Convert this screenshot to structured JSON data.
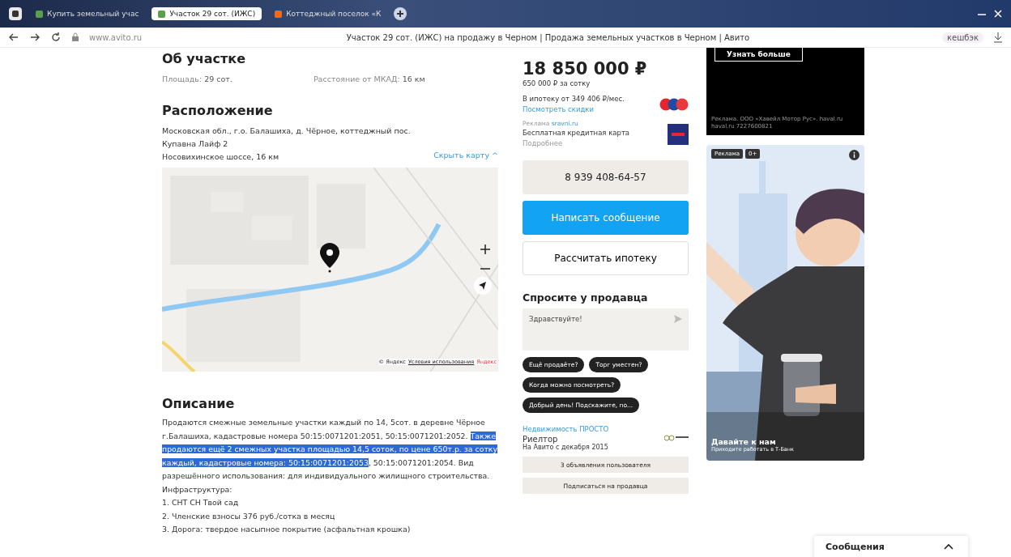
{
  "browser": {
    "tabs": [
      {
        "label": "Купить земельный учас",
        "selected": false
      },
      {
        "label": "Участок 29 сот. (ИЖС)",
        "selected": true
      },
      {
        "label": "Коттеджный поселок «К",
        "selected": false
      }
    ],
    "address": "www.avito.ru",
    "page_title": "Участок 29 сот. (ИЖС) на продажу в Черном | Продажа земельных участков в Черном | Авито",
    "cashback": "кешбэк"
  },
  "about": {
    "heading": "Об участке",
    "params": [
      {
        "label": "Площадь:",
        "value": "29 сот."
      },
      {
        "label": "Расстояние от МКАД:",
        "value": "16 км"
      }
    ]
  },
  "location": {
    "heading": "Расположение",
    "address_lines": [
      "Московская обл., г.о. Балашиха, д. Чёрное, коттеджный пос.",
      "Купавна Лайф 2"
    ],
    "highway": "Носовихинское шоссе, 16 км",
    "hide_map": "Скрыть карту ^",
    "map": {
      "attribution": "© Яндекс",
      "terms": "Условия использования",
      "brand": "Яндекс"
    }
  },
  "description": {
    "heading": "Описание",
    "paragraph": [
      {
        "text": "Продаются смежные земельные участки каждый по 14, 5сот. в деревне Чёрное г.Балашиха, кадастровые номера 50:15:0071201:2051, 50:15:0071201:2052. ",
        "selected": false
      },
      {
        "text": "Также продаются ещё 2 смежных участка площадью 14,5 соток, по цене 650т.р. за сотку каждый, кадастровые номера: 50:15:0071201:2053",
        "selected": true
      },
      {
        "text": ", 50:15:0071201:2054. Вид разрешённого использования: для индивидуального жилищного строительства.",
        "selected": false
      }
    ],
    "lines": [
      "Инфраструктура:",
      "1. СНТ СН Твой сад",
      "2. Членские взносы 376 руб./сотка в месяц",
      "3. Дорога: твердое насыпное покрытие (асфальтная крошка)"
    ]
  },
  "price": {
    "amount": "18 850 000 ₽",
    "per_unit": "650 000 ₽ за сотку",
    "mortgage": "В ипотеку от 349 406 ₽/мес.",
    "discounts_link": "Посмотреть скидки",
    "ad_label": "Реклама",
    "ad_site": "sravni.ru",
    "card_offer": "Бесплатная кредитная карта",
    "card_more": "Подробнее"
  },
  "phone_button": "8 939 408-64-57",
  "message_button": "Написать сообщение",
  "mortgage_button": "Рассчитать ипотеку",
  "ask": {
    "heading": "Спросите у продавца",
    "message": "Здравствуйте!",
    "chips": [
      "Ещё продаёте?",
      "Торг уместен?",
      "Когда можно посмотреть?",
      "Добрый день! Подскажите, по..."
    ]
  },
  "seller": {
    "name": "Недвижимость ПРОСТО",
    "role": "Риелтор",
    "since": "На Авито с декабря 2015",
    "listings_button": "3 объявления пользователя",
    "subscribe_button": "Подписаться на продавца"
  },
  "ads": [
    {
      "kind": "banner",
      "button": "Узнать больше",
      "legal": "Реклама. ООО «Хавейл Мотор Рус». haval.ru",
      "legal_2": "haval.ru 7227600821"
    },
    {
      "kind": "picture",
      "badges": [
        "Реклама",
        "0+"
      ],
      "title": "Давайте к нам",
      "subtitle": "Приходите работать в Т-Банк"
    }
  ],
  "messages_bar": {
    "label": "Сообщения",
    "expanded": false
  }
}
